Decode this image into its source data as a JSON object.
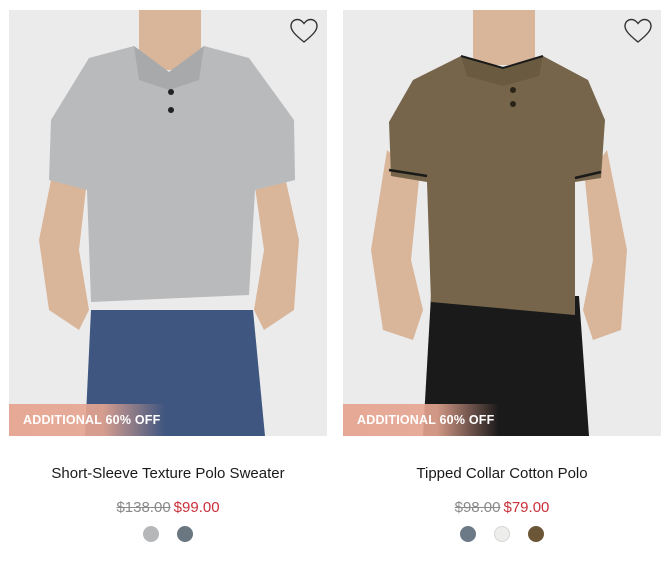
{
  "products": [
    {
      "promo": "ADDITIONAL 60% OFF",
      "title": "Short-Sleeve Texture Polo Sweater",
      "original_price": "$138.00",
      "sale_price": "$99.00",
      "shirt_color": "#b9babb",
      "pants_color": "#3f5680",
      "swatches": [
        "#b5b7b9",
        "#6b7780"
      ]
    },
    {
      "promo": "ADDITIONAL 60% OFF",
      "title": "Tipped Collar Cotton Polo",
      "original_price": "$98.00",
      "sale_price": "$79.00",
      "shirt_color": "#76654a",
      "pants_color": "#1a1a1a",
      "swatches": [
        "#6c7a87",
        "#ededeb",
        "#6b5738"
      ]
    }
  ],
  "icons": {
    "wishlist": "heart-outline-icon"
  },
  "colors": {
    "sale_price": "#c8303a",
    "original_price": "#8a8a8a",
    "promo_badge": "#e6a591",
    "image_bg": "#ebebeb"
  }
}
